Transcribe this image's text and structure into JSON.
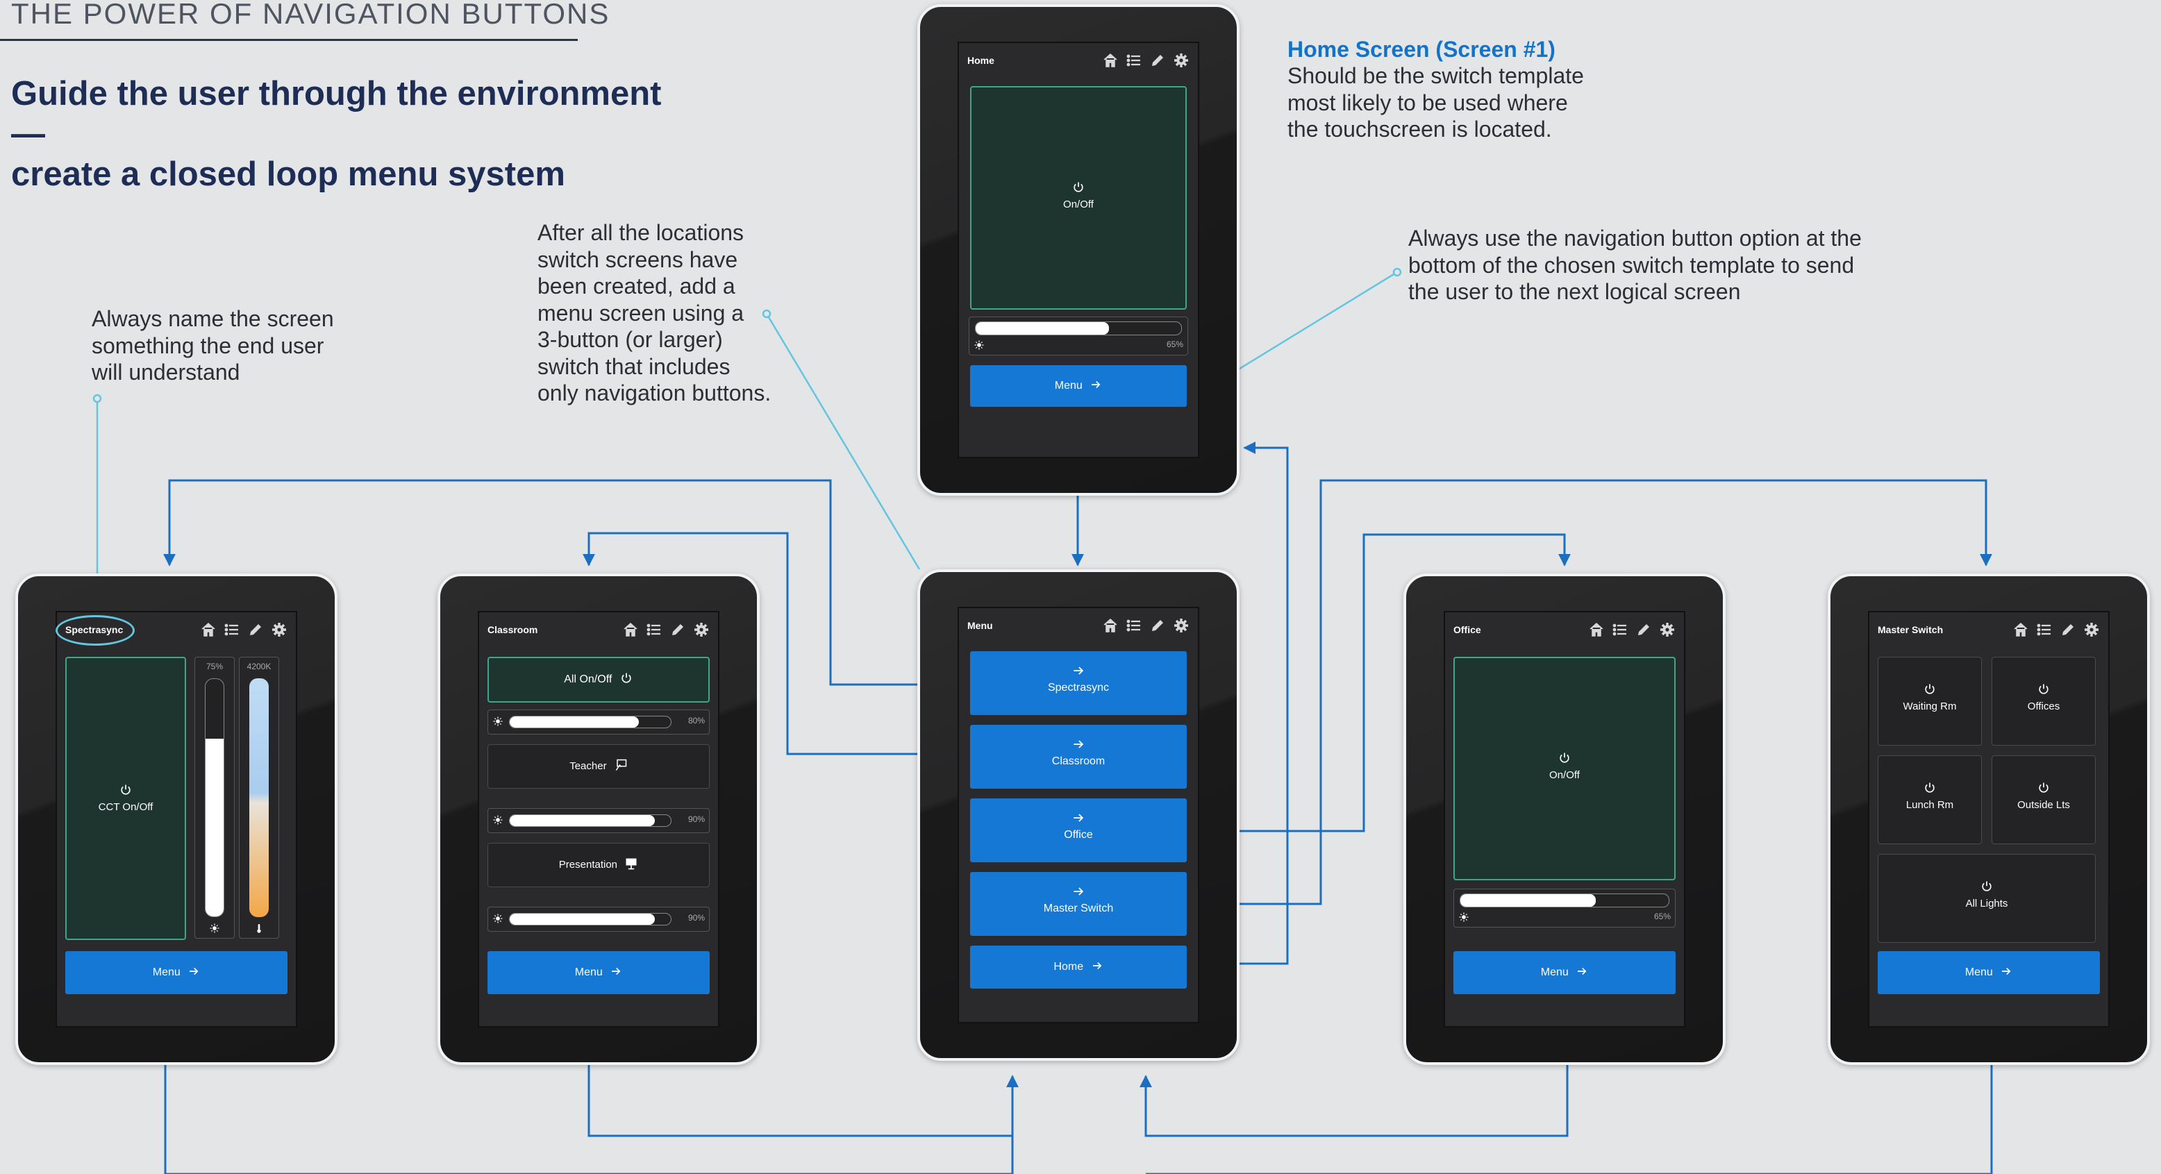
{
  "header": {
    "kicker": "THE POWER OF NAVIGATION BUTTONS",
    "headline_line1": "Guide the user through the environment—",
    "headline_line2": "create a closed loop menu system"
  },
  "notes": {
    "home_title": "Home Screen  (Screen #1)",
    "home_body": [
      "Should be the switch template",
      "most likely to be used where",
      "the touchscreen is located."
    ],
    "nav_button": [
      "Always use the navigation button option at the",
      "bottom of the chosen switch template to send",
      "the user to the next logical screen"
    ],
    "name_screen": [
      "Always name the screen",
      "something the end user",
      "will understand"
    ],
    "menu_screen": [
      "After all the locations",
      "switch screens have",
      "been created, add a",
      "menu screen using a",
      "3-button (or larger)",
      "switch that includes",
      "only navigation buttons."
    ]
  },
  "colors": {
    "accent": "#1478d4",
    "wire": "#1a6fc0",
    "callout": "#62c6de",
    "panel_border": "#3ba88a"
  },
  "icons": [
    "home-icon",
    "list-icon",
    "pencil-icon",
    "gear-icon",
    "power-icon",
    "arrow-right-icon",
    "sun-icon",
    "thermometer-icon",
    "touch-icon",
    "presentation-icon"
  ],
  "screens": {
    "home": {
      "title": "Home",
      "onoff": "On/Off",
      "level": 0.65,
      "pct": "65%",
      "menu": "Menu"
    },
    "spectrasync": {
      "title": "Spectrasync",
      "onoff": "CCT On/Off",
      "level": 0.75,
      "level_label": "75%",
      "cct_label": "4200K",
      "menu": "Menu"
    },
    "classroom": {
      "title": "Classroom",
      "all_onoff": "All On/Off",
      "sliders": [
        {
          "level": 0.8,
          "pct": "80%"
        },
        {
          "level": 0.9,
          "pct": "90%"
        },
        {
          "level": 0.9,
          "pct": "90%"
        }
      ],
      "teacher": "Teacher",
      "presentation": "Presentation",
      "menu": "Menu"
    },
    "menu": {
      "title": "Menu",
      "buttons": [
        "Spectrasync",
        "Classroom",
        "Office",
        "Master Switch"
      ],
      "home": "Home"
    },
    "office": {
      "title": "Office",
      "onoff": "On/Off",
      "level": 0.65,
      "pct": "65%",
      "menu": "Menu"
    },
    "master": {
      "title": "Master Switch",
      "buttons": [
        "Waiting Rm",
        "Offices",
        "Lunch Rm",
        "Outside Lts"
      ],
      "all": "All Lights",
      "menu": "Menu"
    }
  }
}
